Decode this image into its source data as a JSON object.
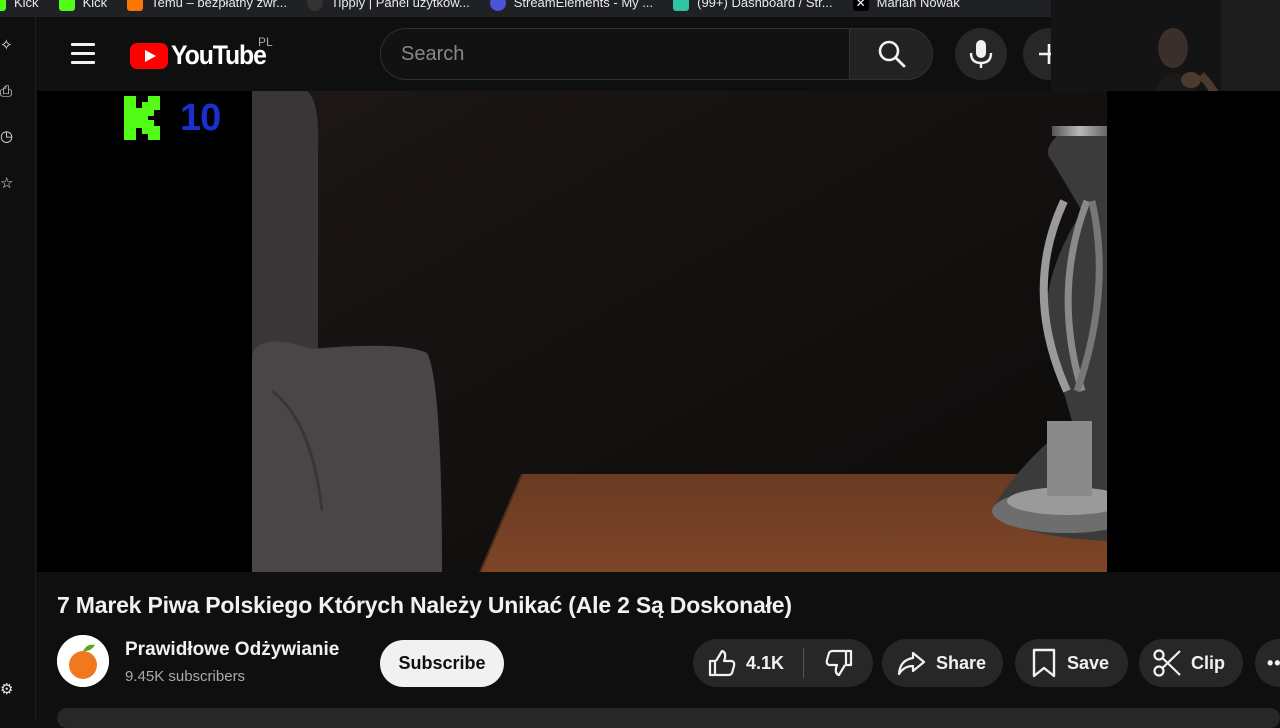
{
  "bookmarks": [
    {
      "label": "Kick",
      "icon": "kick-icon",
      "color": "#53fc18"
    },
    {
      "label": "Kick",
      "icon": "kick-icon",
      "color": "#53fc18"
    },
    {
      "label": "Temu – bezpłatny zwr...",
      "icon": "temu-icon",
      "color": "#fb7701"
    },
    {
      "label": "Tipply | Panel użytkow...",
      "icon": "tipply-icon",
      "color": "#333333"
    },
    {
      "label": "StreamElements - My ...",
      "icon": "streamelements-icon",
      "color": "#4d53d6"
    },
    {
      "label": "(99+) Dashboard / Str...",
      "icon": "dashboard-icon",
      "color": "#2ec4a4"
    },
    {
      "label": "Marian Nowak",
      "icon": "x-icon",
      "color": "#000000"
    }
  ],
  "header": {
    "logo_text": "YouTube",
    "region": "PL",
    "search_placeholder": "Search"
  },
  "overlay": {
    "counter_value": "10",
    "counter_icon": "kick-logo-icon"
  },
  "video": {
    "title": "7 Marek Piwa Polskiego Których Należy Unikać (Ale 2 Są Doskonałe)"
  },
  "channel": {
    "name": "Prawidłowe Odżywianie",
    "subscribers": "9.45K subscribers",
    "subscribe_label": "Subscribe"
  },
  "actions": {
    "likes": "4.1K",
    "share_label": "Share",
    "save_label": "Save",
    "clip_label": "Clip"
  },
  "colors": {
    "brand_red": "#ff0000",
    "kick_green": "#53fc18",
    "counter_blue": "#1830d0"
  }
}
